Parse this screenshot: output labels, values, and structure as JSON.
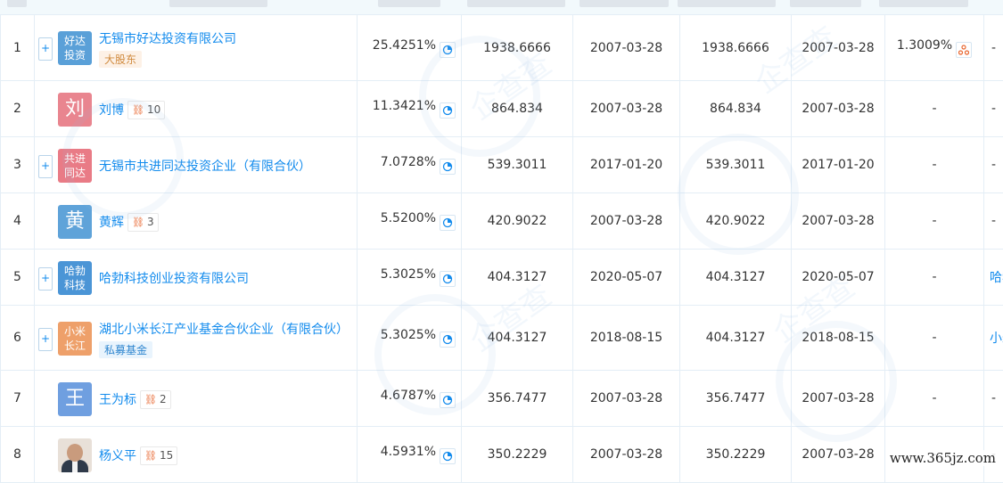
{
  "rows": [
    {
      "idx": "1",
      "expandable": true,
      "logo_text": [
        "好达",
        "投资"
      ],
      "logo_color": "#5aa0d8",
      "name": "无锡市好达投资有限公司",
      "badge": "大股东",
      "badge_type": "holder",
      "relation_count": "",
      "ratio": "25.4251%",
      "sub_amount": "1938.6666",
      "sub_date": "2007-03-28",
      "paid_amount": "1938.6666",
      "paid_date": "2007-03-28",
      "indirect": "1.3009%",
      "last": "-"
    },
    {
      "idx": "2",
      "expandable": false,
      "logo_text": [
        "刘"
      ],
      "logo_color": "#e9858f",
      "name": "刘博",
      "badge": "",
      "badge_type": "",
      "relation_count": "10",
      "ratio": "11.3421%",
      "sub_amount": "864.834",
      "sub_date": "2007-03-28",
      "paid_amount": "864.834",
      "paid_date": "2007-03-28",
      "indirect": "-",
      "last": "-"
    },
    {
      "idx": "3",
      "expandable": true,
      "logo_text": [
        "共进",
        "同达"
      ],
      "logo_color": "#e97b86",
      "name": "无锡市共进同达投资企业（有限合伙）",
      "badge": "",
      "badge_type": "",
      "relation_count": "",
      "ratio": "7.0728%",
      "sub_amount": "539.3011",
      "sub_date": "2017-01-20",
      "paid_amount": "539.3011",
      "paid_date": "2017-01-20",
      "indirect": "-",
      "last": "-"
    },
    {
      "idx": "4",
      "expandable": false,
      "logo_text": [
        "黄"
      ],
      "logo_color": "#5fa3d9",
      "name": "黄辉",
      "badge": "",
      "badge_type": "",
      "relation_count": "3",
      "ratio": "5.5200%",
      "sub_amount": "420.9022",
      "sub_date": "2007-03-28",
      "paid_amount": "420.9022",
      "paid_date": "2007-03-28",
      "indirect": "-",
      "last": "-"
    },
    {
      "idx": "5",
      "expandable": true,
      "logo_text": [
        "哈勃",
        "科技"
      ],
      "logo_color": "#4b95d6",
      "name": "哈勃科技创业投资有限公司",
      "badge": "",
      "badge_type": "",
      "relation_count": "",
      "ratio": "5.3025%",
      "sub_amount": "404.3127",
      "sub_date": "2020-05-07",
      "paid_amount": "404.3127",
      "paid_date": "2020-05-07",
      "indirect": "-",
      "last": "哈勃"
    },
    {
      "idx": "6",
      "expandable": true,
      "logo_text": [
        "小米",
        "长江"
      ],
      "logo_color": "#eea06a",
      "name": "湖北小米长江产业基金合伙企业（有限合伙）",
      "badge": "私募基金",
      "badge_type": "fund",
      "relation_count": "",
      "ratio": "5.3025%",
      "sub_amount": "404.3127",
      "sub_date": "2018-08-15",
      "paid_amount": "404.3127",
      "paid_date": "2018-08-15",
      "indirect": "-",
      "last": "小米"
    },
    {
      "idx": "7",
      "expandable": false,
      "logo_text": [
        "王"
      ],
      "logo_color": "#6f9fe0",
      "name": "王为标",
      "badge": "",
      "badge_type": "",
      "relation_count": "2",
      "ratio": "4.6787%",
      "sub_amount": "356.7477",
      "sub_date": "2007-03-28",
      "paid_amount": "356.7477",
      "paid_date": "2007-03-28",
      "indirect": "-",
      "last": "-"
    },
    {
      "idx": "8",
      "expandable": false,
      "logo_text": [],
      "logo_color": "photo",
      "name": "杨义平",
      "badge": "",
      "badge_type": "",
      "relation_count": "15",
      "ratio": "4.5931%",
      "sub_amount": "350.2229",
      "sub_date": "2007-03-28",
      "paid_amount": "350.2229",
      "paid_date": "2007-03-28",
      "indirect": "-",
      "last": "-"
    }
  ],
  "site_watermark": "www.365jz.com",
  "bg_watermark": "企查查 Qcc.com",
  "colors": {
    "link": "#128bed",
    "border": "#e4eef6",
    "header_bg": "#f2f9fc"
  }
}
